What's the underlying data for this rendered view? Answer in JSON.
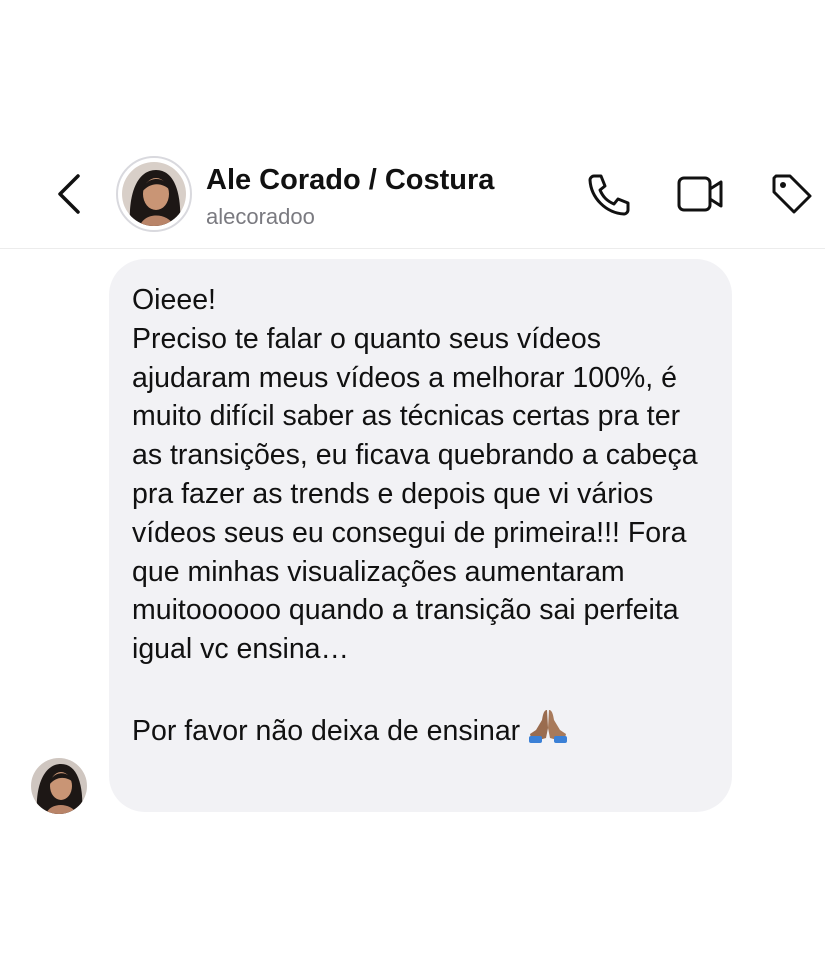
{
  "header": {
    "contact_name": "Ale Corado / Costura",
    "username": "alecoradoo",
    "icons": [
      "chevron-left-icon",
      "phone-icon",
      "video-camera-icon",
      "tag-icon"
    ]
  },
  "message": {
    "text": "Oieee!\nPreciso te falar o quanto seus vídeos ajudaram meus vídeos a melhorar 100%, é muito difícil saber as técnicas certas pra ter as transições, eu ficava quebrando a cabeça pra fazer as trends e depois que vi vários vídeos seus eu consegui de primeira!!! Fora que minhas visualizações aumentaram muitoooooo quando a transição sai perfeita igual vc ensina…\n\nPor favor não deixa de ensinar",
    "emoji": "praying-hands-emoji"
  },
  "colors": {
    "bubble": "#f2f2f5",
    "text": "#111111",
    "muted": "#7a7a80",
    "divider": "#ececec"
  }
}
